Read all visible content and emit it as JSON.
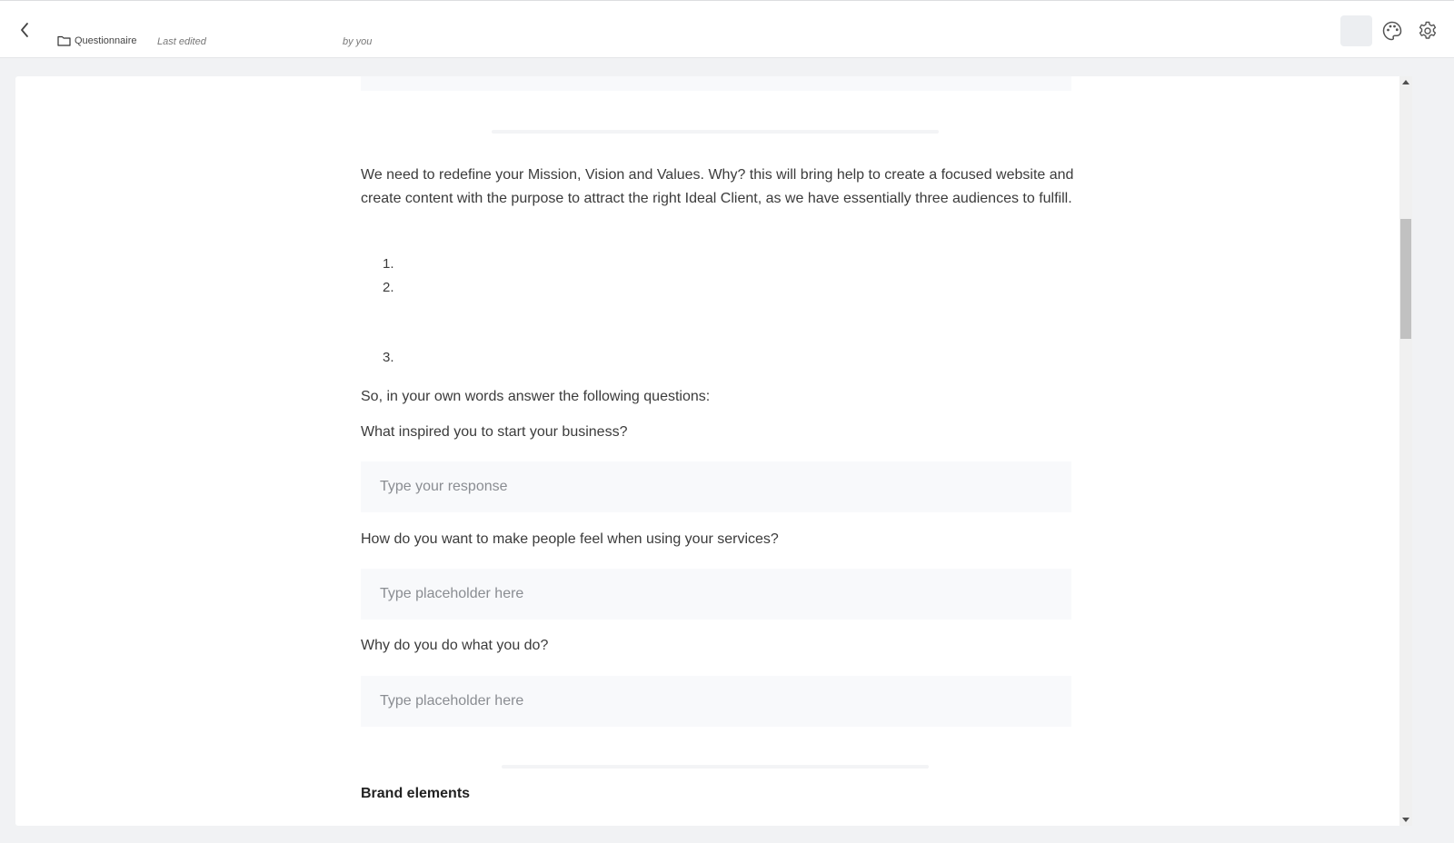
{
  "header": {
    "folder_label": "Questionnaire",
    "last_edited": "Last edited",
    "by": "by you"
  },
  "content": {
    "intro": "We need to redefine your Mission, Vision and Values. Why? this will bring help to create a focused website and create content with the purpose to attract the right Ideal Client, as we have essentially three audiences to fulfill.",
    "list": [
      "1.",
      "2.",
      "3."
    ],
    "lead": "So, in your own words answer the following questions:",
    "questions": [
      {
        "label": "What inspired you to start your business?",
        "placeholder": "Type your response"
      },
      {
        "label": "How do you want to make people feel when using your services?",
        "placeholder": "Type placeholder here"
      },
      {
        "label": "Why do you do what you do?",
        "placeholder": "Type placeholder here"
      }
    ],
    "section_title": "Brand elements"
  },
  "colors": {
    "page_bg": "#f1f2f4",
    "field_bg": "#f8f9fb",
    "text": "#3b3b3b"
  },
  "icons": [
    "chevron-left-icon",
    "folder-icon",
    "palette-icon",
    "gear-icon"
  ]
}
